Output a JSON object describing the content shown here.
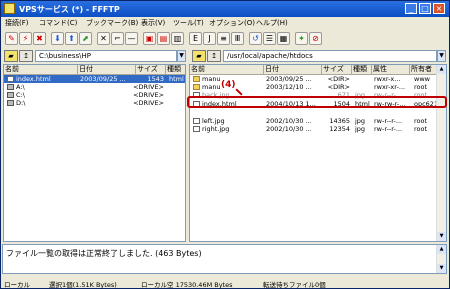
{
  "title": "VPSサービス (*) - FFFTP",
  "menu": [
    "接続(F)",
    "コマンド(C)",
    "ブックマーク(B)",
    "表示(V)",
    "ツール(T)",
    "オプション(O)",
    "ヘルプ(H)"
  ],
  "local": {
    "path": "C:\\business\\HP",
    "headers": [
      "名前",
      "日付",
      "サイズ",
      "種類"
    ],
    "rows": [
      {
        "name": "index.html",
        "date": "2003/09/25 ...",
        "size": "1543",
        "type": "html",
        "icon": "file",
        "selected": true
      },
      {
        "name": "A:\\",
        "date": "",
        "size": "<DRIVE>",
        "type": "",
        "icon": "drive",
        "selected": false
      },
      {
        "name": "C:\\",
        "date": "",
        "size": "<DRIVE>",
        "type": "",
        "icon": "drive",
        "selected": false
      },
      {
        "name": "D:\\",
        "date": "",
        "size": "<DRIVE>",
        "type": "",
        "icon": "drive",
        "selected": false
      }
    ]
  },
  "remote": {
    "path": "/usr/local/apache/htdocs",
    "headers": [
      "名前",
      "日付",
      "サイズ",
      "種類",
      "属性",
      "所有者"
    ],
    "rows": [
      {
        "name": "manu",
        "date": "2003/09/25 ...",
        "size": "<DIR>",
        "type": "",
        "attr": "rwxr-x...",
        "owner": "www",
        "icon": "folder"
      },
      {
        "name": "manu",
        "date": "2003/12/10 ...",
        "size": "<DIR>",
        "type": "",
        "attr": "rwxr-xr-...",
        "owner": "root",
        "icon": "folder"
      },
      {
        "name": "back.jpg",
        "date": "",
        "size": "671",
        "type": "jpg",
        "attr": "rw-r--r-...",
        "owner": "root",
        "icon": "file"
      },
      {
        "name": "index.html",
        "date": "2004/10/13 1...",
        "size": "1504",
        "type": "html",
        "attr": "rw-rw-r-...",
        "owner": "opc6211",
        "icon": "file"
      },
      {
        "name": "left.jpg",
        "date": "2002/10/30 ...",
        "size": "14365",
        "type": "jpg",
        "attr": "rw-r--r-...",
        "owner": "root",
        "icon": "file"
      },
      {
        "name": "right.jpg",
        "date": "2002/10/30 ...",
        "size": "12354",
        "type": "jpg",
        "attr": "rw-r--r-...",
        "owner": "root",
        "icon": "file"
      }
    ]
  },
  "annotation": "(4)",
  "log": "ファイル一覧の取得は正常終了しました. (463 Bytes)",
  "status": {
    "location": "ローカル",
    "selected": "選択1個(1.51K Bytes)",
    "free": "ローカル空 17530.46M Bytes",
    "queue": "転送待ちファイル0個"
  },
  "colors": {
    "title": "#0b4fc4",
    "selection": "#316ac5",
    "highlight": "#c00000"
  }
}
